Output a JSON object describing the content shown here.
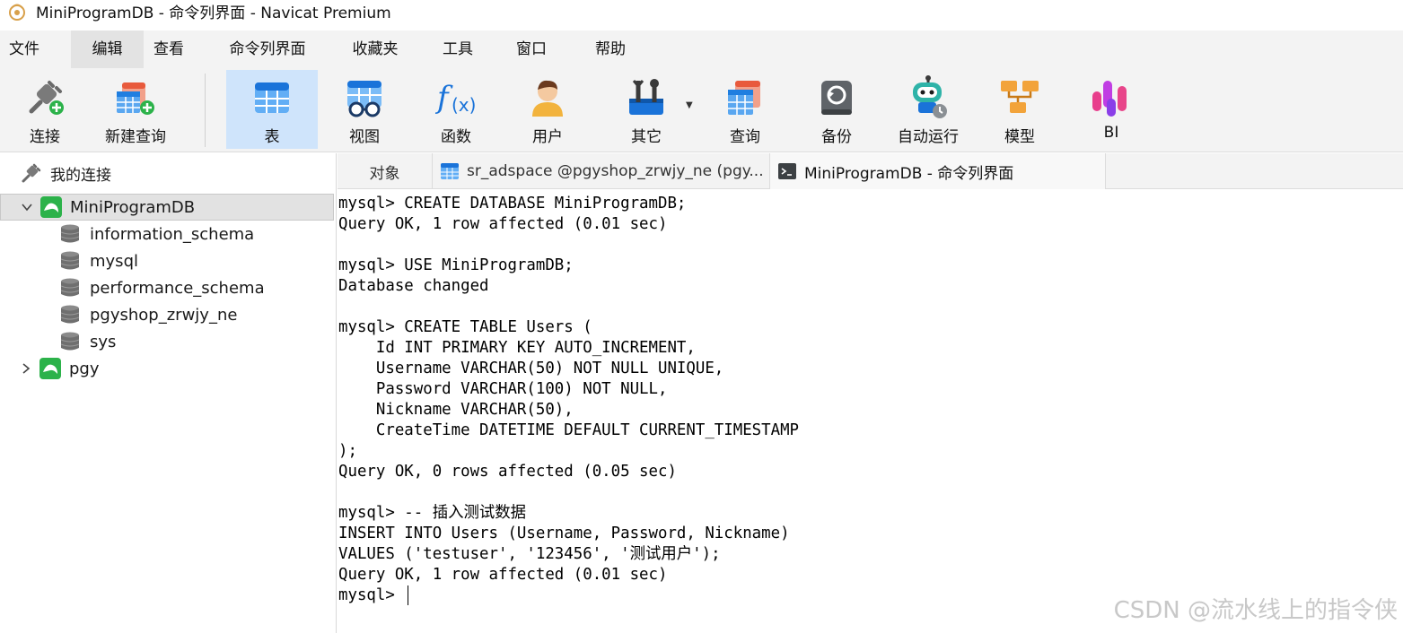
{
  "window": {
    "title": "MiniProgramDB - 命令列界面 - Navicat Premium"
  },
  "menu": [
    "文件",
    "编辑",
    "查看",
    "命令列界面",
    "收藏夹",
    "工具",
    "窗口",
    "帮助"
  ],
  "toolbar": {
    "connect": "连接",
    "new_query": "新建查询",
    "table": "表",
    "view": "视图",
    "function": "函数",
    "user": "用户",
    "other": "其它",
    "query": "查询",
    "backup": "备份",
    "automation": "自动运行",
    "model": "模型",
    "bi": "BI"
  },
  "sidebar": {
    "header": "我的连接",
    "connections": [
      {
        "name": "MiniProgramDB",
        "expanded": true,
        "databases": [
          "information_schema",
          "mysql",
          "performance_schema",
          "pgyshop_zrwjy_ne",
          "sys"
        ]
      },
      {
        "name": "pgy",
        "expanded": false
      }
    ]
  },
  "tabs": [
    "对象",
    "sr_adspace @pgyshop_zrwjy_ne (pgy...",
    "MiniProgramDB - 命令列界面"
  ],
  "console": [
    "mysql> CREATE DATABASE MiniProgramDB;",
    "Query OK, 1 row affected (0.01 sec)",
    "",
    "mysql> USE MiniProgramDB;",
    "Database changed",
    "",
    "mysql> CREATE TABLE Users (",
    "    Id INT PRIMARY KEY AUTO_INCREMENT,",
    "    Username VARCHAR(50) NOT NULL UNIQUE,",
    "    Password VARCHAR(100) NOT NULL,",
    "    Nickname VARCHAR(50),",
    "    CreateTime DATETIME DEFAULT CURRENT_TIMESTAMP",
    ");",
    "Query OK, 0 rows affected (0.05 sec)",
    "",
    "mysql> -- 插入测试数据",
    "INSERT INTO Users (Username, Password, Nickname)",
    "VALUES ('testuser', '123456', '测试用户');",
    "Query OK, 1 row affected (0.01 sec)",
    "mysql> "
  ],
  "watermark": "CSDN @流水线上的指令侠",
  "colors": {
    "accent": "#0a74da",
    "selected_tab": "#cfe4fb",
    "conn_green": "#2cb24a"
  }
}
